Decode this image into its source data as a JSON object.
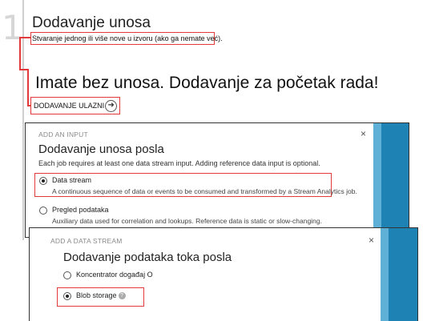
{
  "step": {
    "number": "1",
    "title": "Dodavanje unosa",
    "description": "Stvaranje jednog ili više nove u izvoru (ako ga nemate već)."
  },
  "empty_state": {
    "headline": "Imate bez unosa. Dodavanje za početak rada!",
    "add_link": "DODAVANJE ULAZNI"
  },
  "input_panel": {
    "header": "ADD AN INPUT",
    "title": "Dodavanje unosa posla",
    "intro": "Each job requires at least one data stream input. Adding reference data input is optional.",
    "options": [
      {
        "label": "Data stream",
        "description": "A continuous sequence of data or events to be consumed and transformed by a Stream Analytics job.",
        "selected": true
      },
      {
        "label": "Pregled podataka",
        "description": "Auxiliary data used for correlation and lookups. Reference data is static or slow-changing.",
        "selected": false
      }
    ],
    "close": "×",
    "accent_color": "#1e82b4"
  },
  "stream_panel": {
    "header": "ADD A DATA STREAM",
    "title": "Dodavanje podataka toka posla",
    "options": [
      {
        "label": "Koncentrator događaj O",
        "selected": false
      },
      {
        "label": "Blob storage",
        "selected": true
      }
    ],
    "help": "?",
    "close": "×",
    "accent_color": "#1e82b4"
  }
}
